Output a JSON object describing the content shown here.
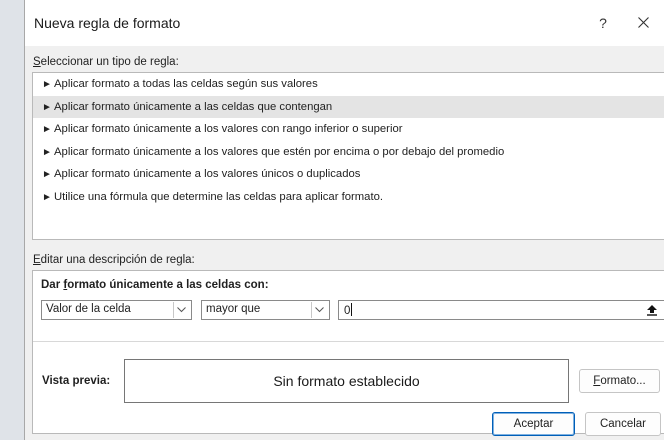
{
  "dialog": {
    "title": "Nueva regla de formato",
    "help_label": "?",
    "select_type": {
      "label_mnemonic": "S",
      "label_rest": "eleccionar un tipo de regla:"
    },
    "rule_types": [
      {
        "label": "Aplicar formato a todas las celdas según sus valores",
        "selected": false
      },
      {
        "label": "Aplicar formato únicamente a las celdas que contengan",
        "selected": true
      },
      {
        "label": "Aplicar formato únicamente a los valores con rango inferior o superior",
        "selected": false
      },
      {
        "label": "Aplicar formato únicamente a los valores que estén por encima o por debajo del promedio",
        "selected": false
      },
      {
        "label": "Aplicar formato únicamente a los valores únicos o duplicados",
        "selected": false
      },
      {
        "label": "Utilice una fórmula que determine las celdas para aplicar formato.",
        "selected": false
      }
    ],
    "edit_desc": {
      "label_mnemonic": "E",
      "label_rest": "ditar una descripción de regla:"
    },
    "format_only": {
      "pre": "Dar ",
      "mnemonic": "f",
      "post": "ormato únicamente a las celdas con:"
    },
    "condition": {
      "field": "Valor de la celda",
      "operator": "mayor que",
      "value": "0"
    },
    "preview": {
      "label": "Vista previa:",
      "text": "Sin formato establecido"
    },
    "format_button": {
      "mnemonic": "F",
      "rest": "ormato..."
    },
    "ok_button": "Aceptar",
    "cancel_button": "Cancelar"
  }
}
